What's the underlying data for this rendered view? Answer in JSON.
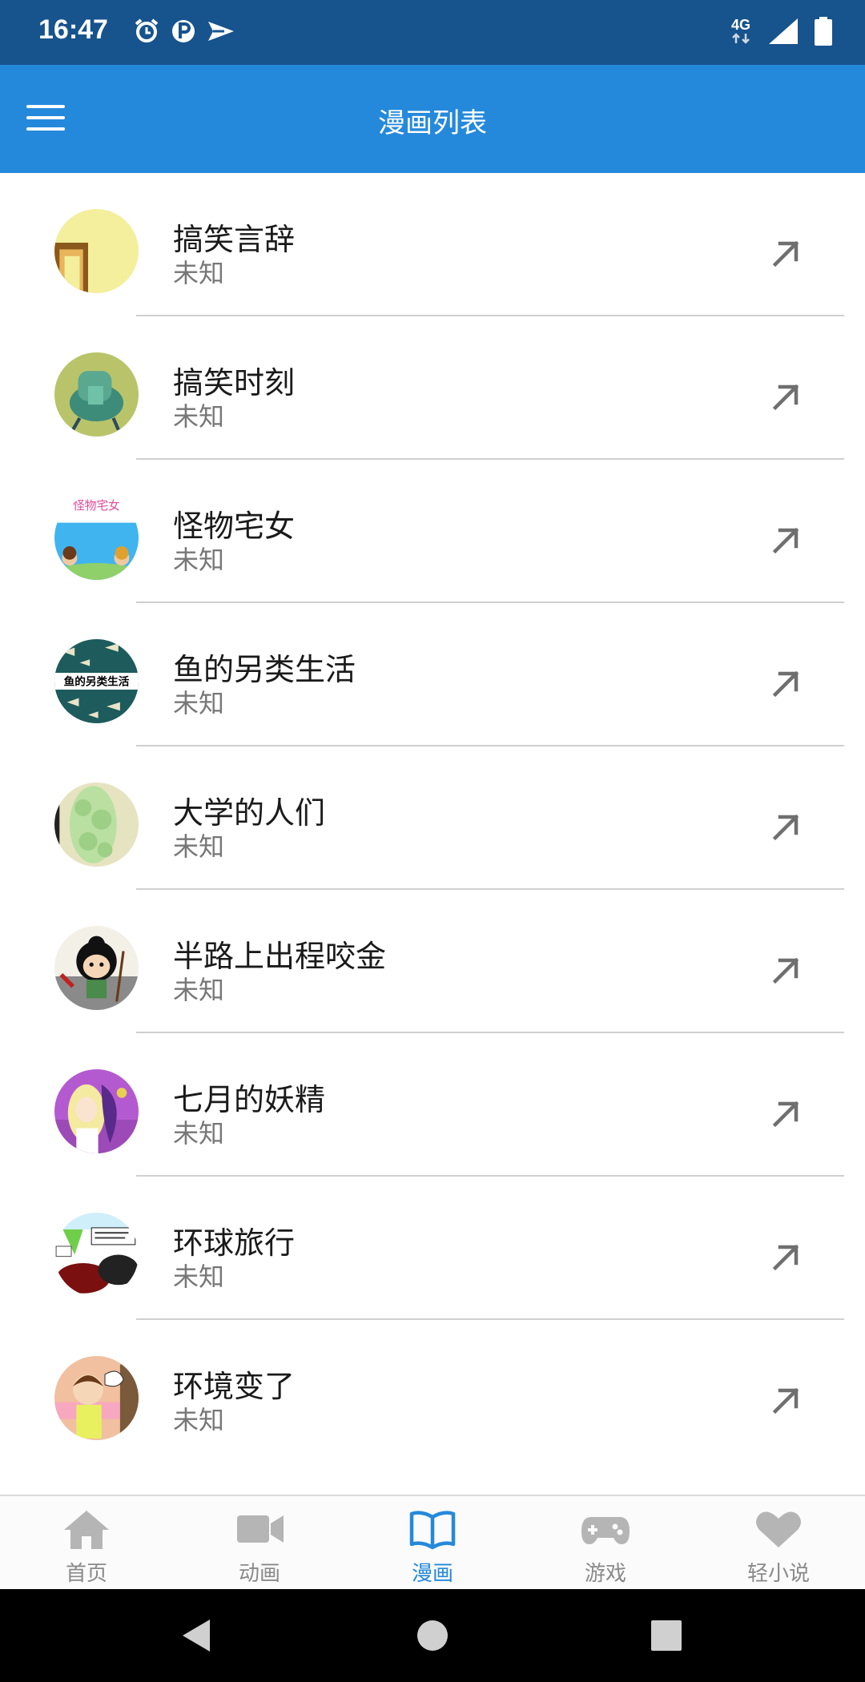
{
  "status_bar": {
    "time": "16:47",
    "network": "4G",
    "icons": [
      "alarm-icon",
      "parking-icon",
      "send-icon",
      "signal-icon",
      "battery-icon"
    ]
  },
  "app_bar": {
    "title": "漫画列表",
    "menu_icon": "hamburger-menu-icon"
  },
  "comics": [
    {
      "title": "搞笑言辞",
      "subtitle": "未知",
      "avatar": "comic-cover-1"
    },
    {
      "title": "搞笑时刻",
      "subtitle": "未知",
      "avatar": "comic-cover-2"
    },
    {
      "title": "怪物宅女",
      "subtitle": "未知",
      "avatar": "comic-cover-3"
    },
    {
      "title": "鱼的另类生活",
      "subtitle": "未知",
      "avatar": "comic-cover-4"
    },
    {
      "title": "大学的人们",
      "subtitle": "未知",
      "avatar": "comic-cover-5"
    },
    {
      "title": "半路上出程咬金",
      "subtitle": "未知",
      "avatar": "comic-cover-6"
    },
    {
      "title": "七月的妖精",
      "subtitle": "未知",
      "avatar": "comic-cover-7"
    },
    {
      "title": "环球旅行",
      "subtitle": "未知",
      "avatar": "comic-cover-8"
    },
    {
      "title": "环境变了",
      "subtitle": "未知",
      "avatar": "comic-cover-9"
    }
  ],
  "bottom_nav": [
    {
      "label": "首页",
      "icon": "home-icon",
      "active": false
    },
    {
      "label": "动画",
      "icon": "video-camera-icon",
      "active": false
    },
    {
      "label": "漫画",
      "icon": "book-icon",
      "active": true
    },
    {
      "label": "游戏",
      "icon": "gamepad-icon",
      "active": false
    },
    {
      "label": "轻小说",
      "icon": "heart-icon",
      "active": false
    }
  ],
  "colors": {
    "status_bar": "#17538d",
    "app_bar": "#2589db",
    "accent": "#2589db",
    "inactive_nav": "#8a8a8a"
  }
}
